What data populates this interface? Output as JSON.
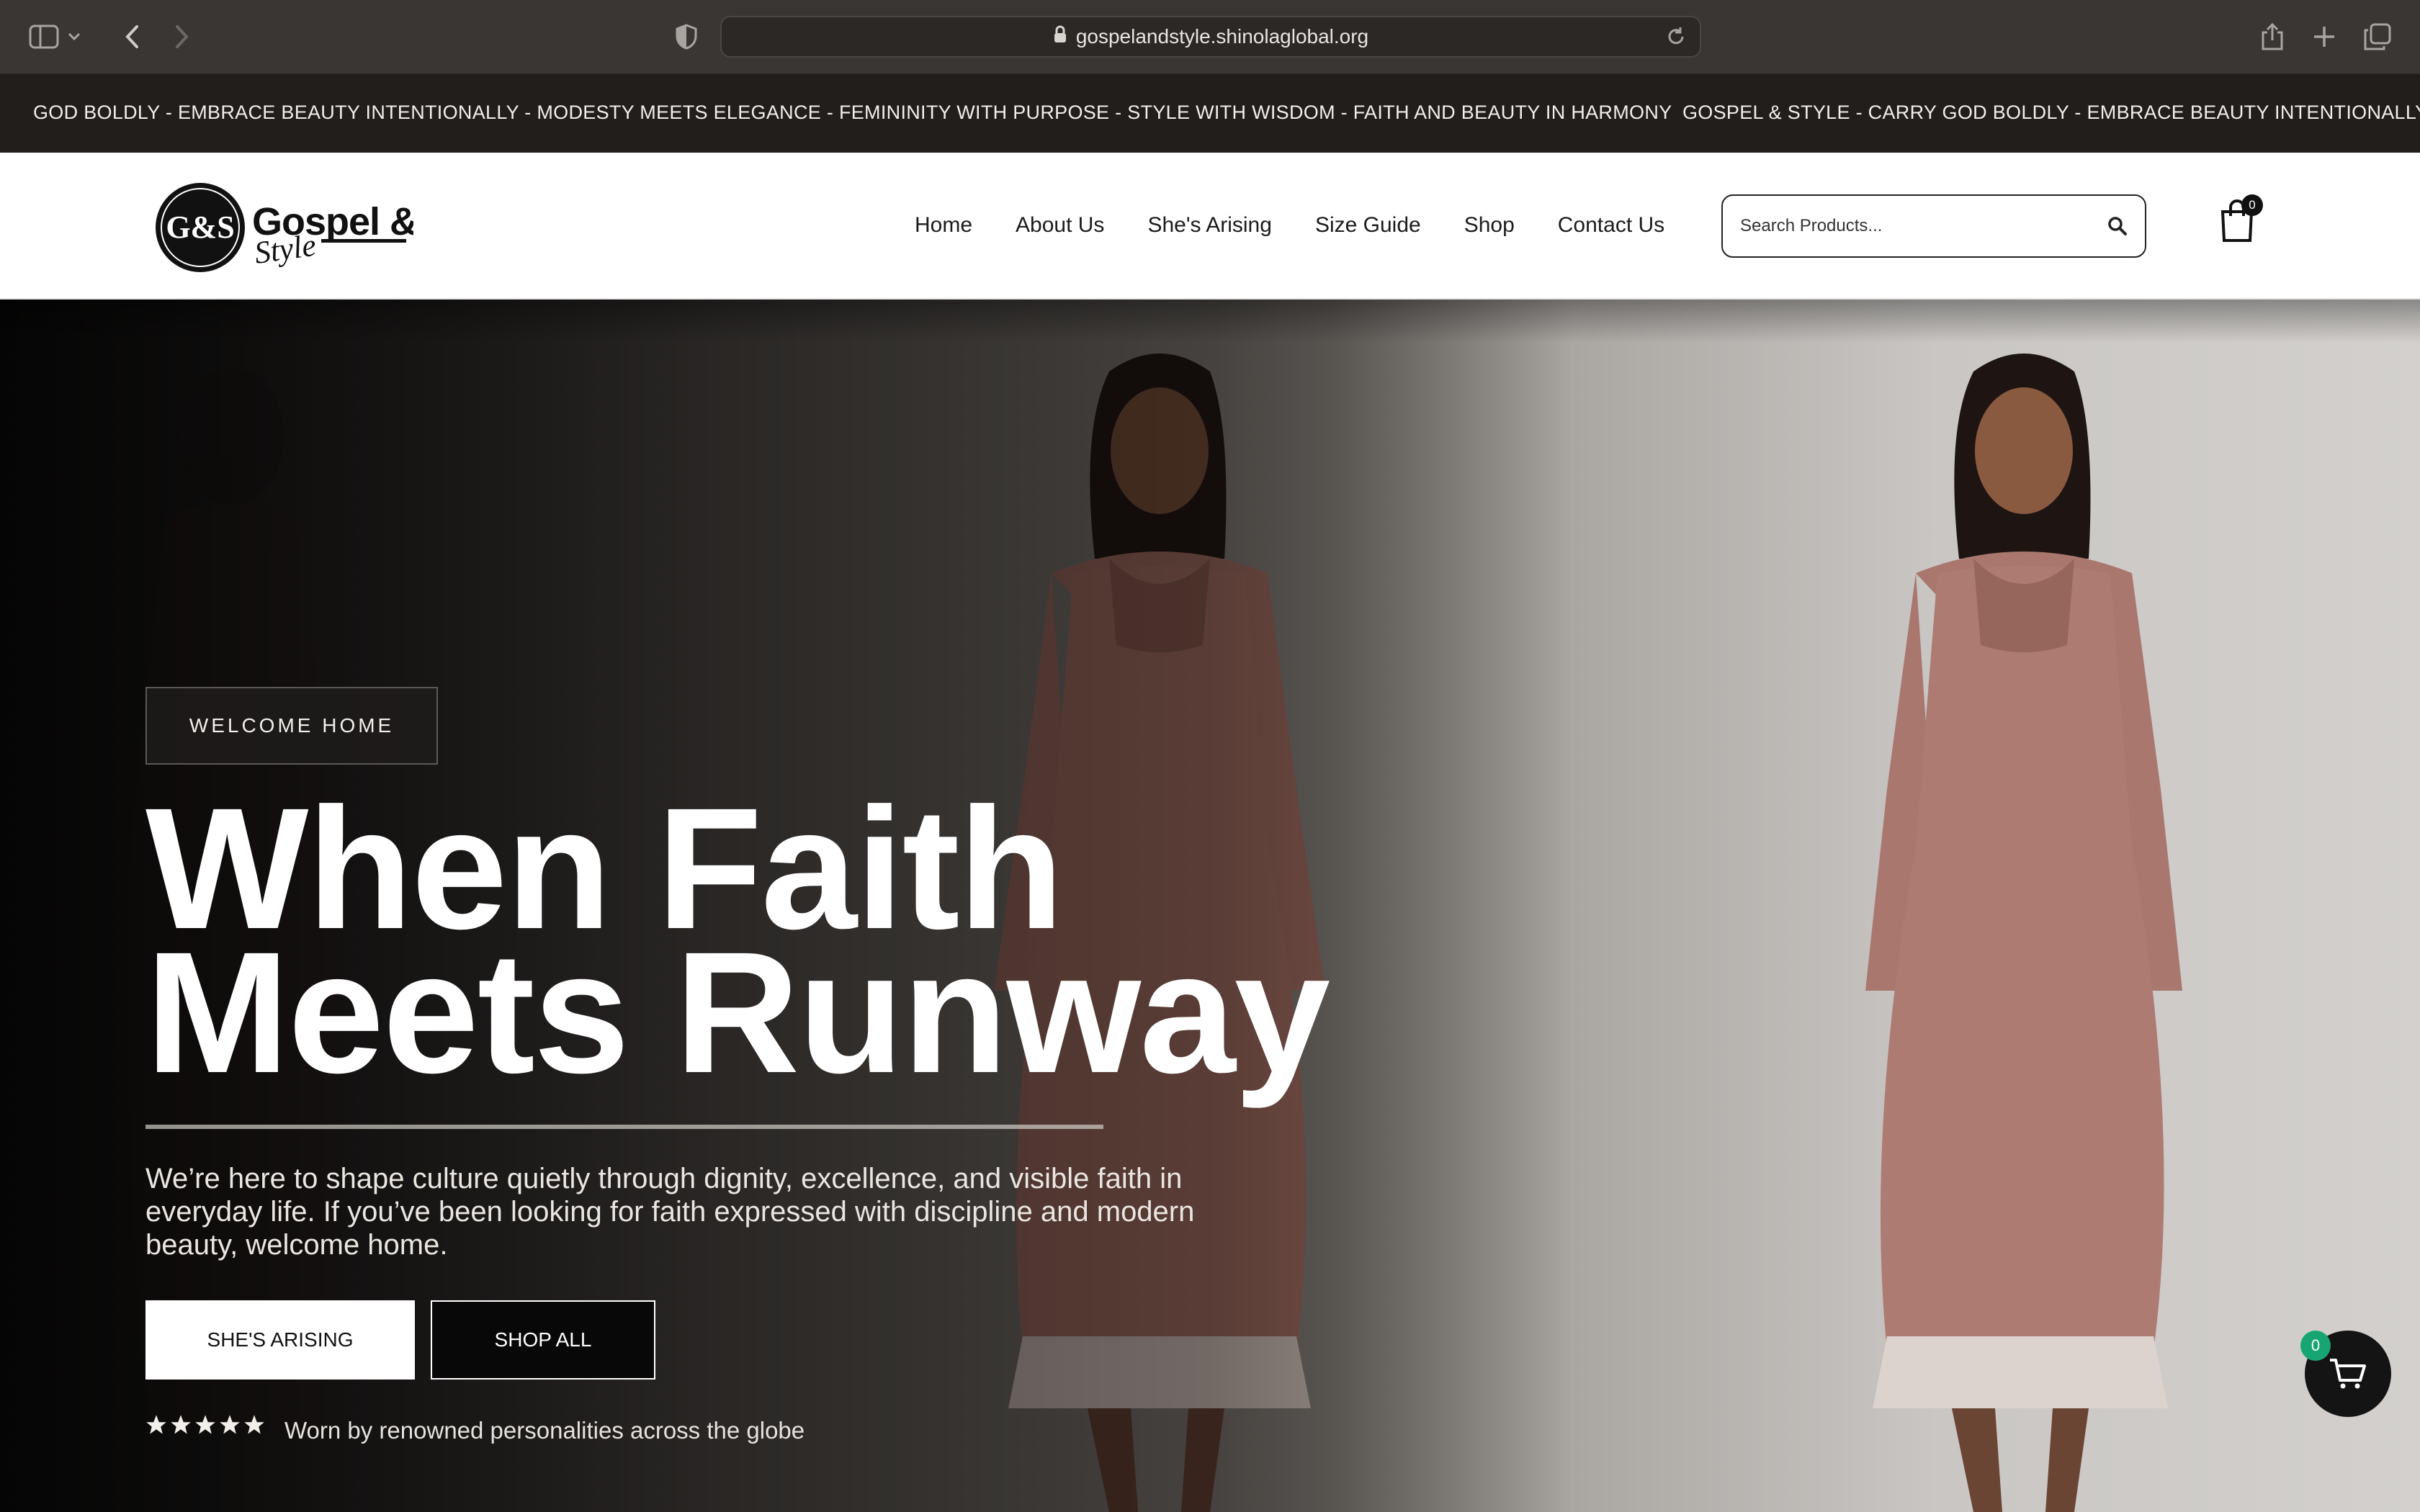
{
  "browser": {
    "url": "gospelandstyle.shinolaglobal.org"
  },
  "marquee": {
    "text_a": "GOD BOLDLY - EMBRACE BEAUTY INTENTIONALLY - MODESTY MEETS ELEGANCE - FEMININITY WITH PURPOSE - STYLE WITH WISDOM - FAITH AND BEAUTY IN HARMONY",
    "text_b": "GOSPEL & STYLE - CARRY GOD BOLDLY - EMBRACE BEAUTY INTENTIONALLY"
  },
  "header": {
    "logo_monogram": "G&S",
    "logo_wordmark": "Gospel &",
    "logo_script": "Style",
    "nav": [
      "Home",
      "About Us",
      "She's Arising",
      "Size Guide",
      "Shop",
      "Contact Us"
    ],
    "search_placeholder": "Search Products...",
    "cart_count": "0"
  },
  "hero": {
    "eyebrow": "WELCOME HOME",
    "headline_line1": "When Faith",
    "headline_line2": "Meets Runway",
    "lede": "We’re here to shape culture quietly through dignity, excellence, and visible faith in everyday life. If you’ve been looking for faith expressed with discipline and modern beauty, welcome home.",
    "primary_button": "SHE'S ARISING",
    "secondary_button": "SHOP ALL",
    "rating_stars": 5,
    "social_proof": "Worn by renowned personalities across the globe"
  },
  "floating_cart": {
    "count": "0",
    "accent": "#17a673"
  }
}
